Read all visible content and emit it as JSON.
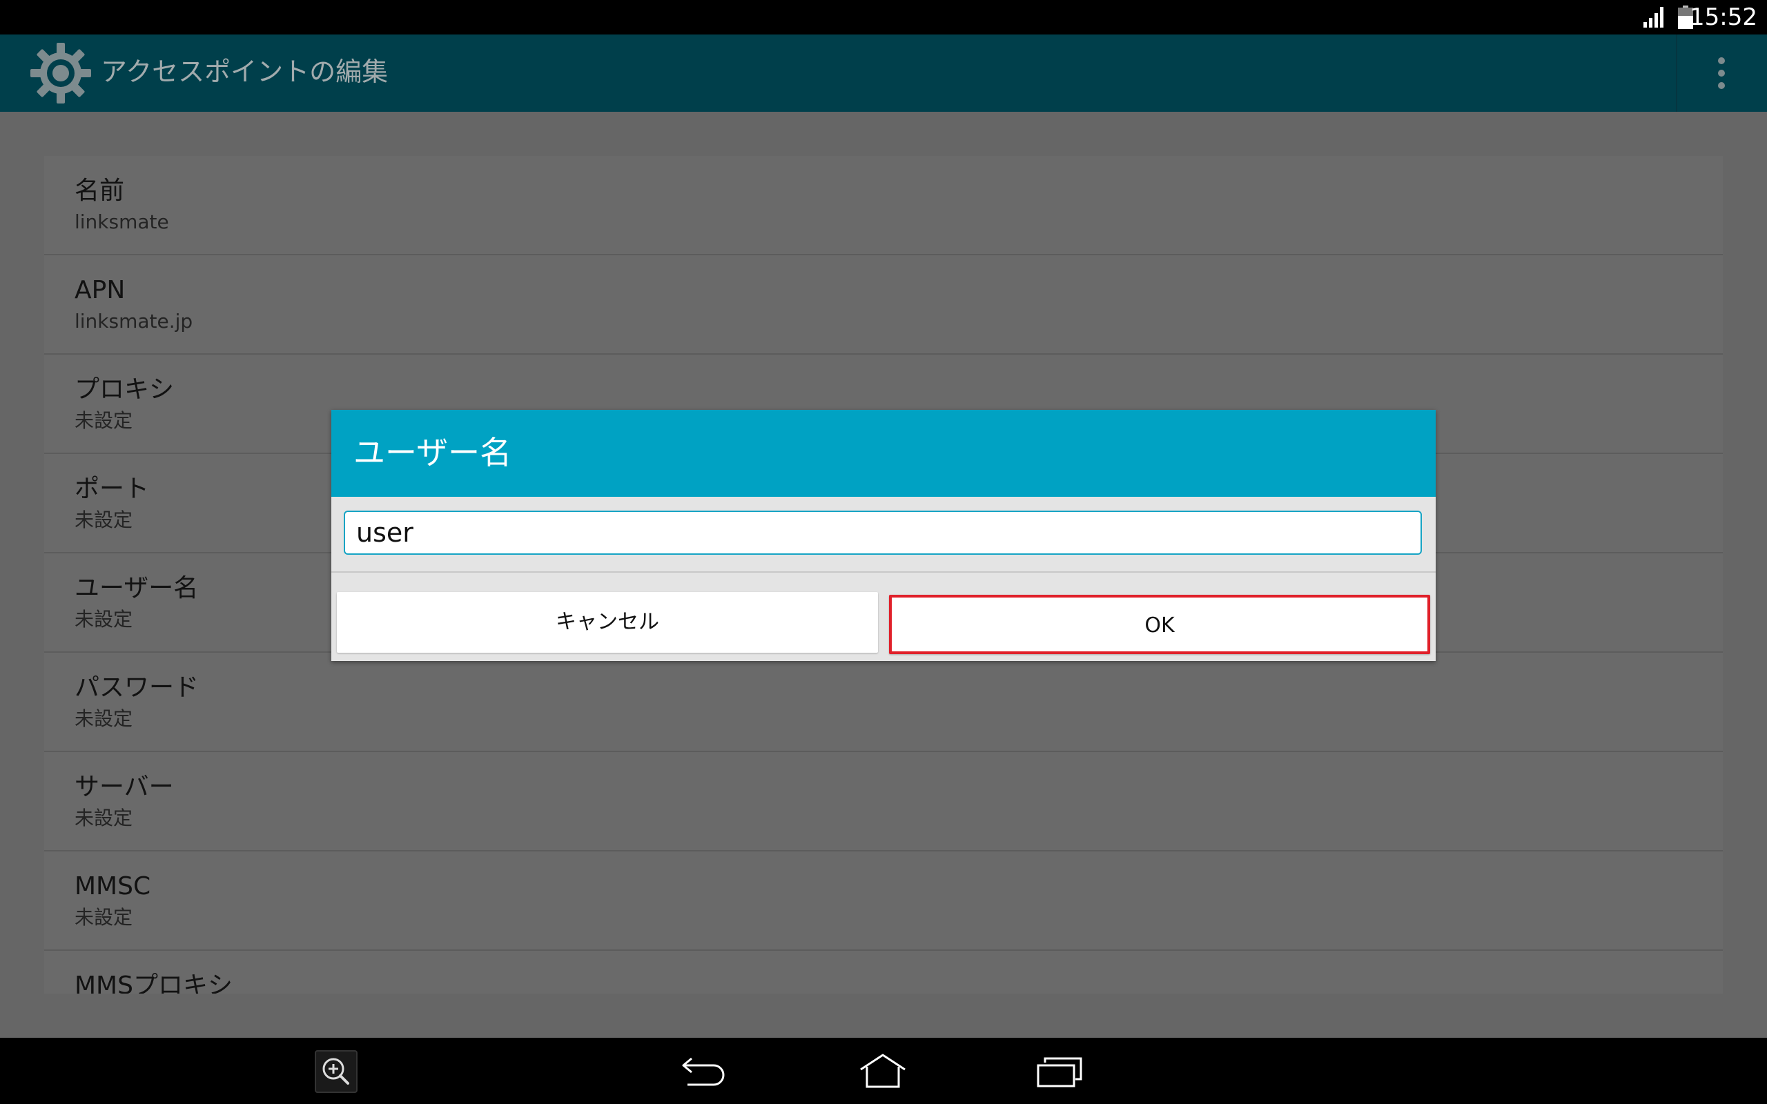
{
  "status_bar": {
    "time": "15:52"
  },
  "action_bar": {
    "title": "アクセスポイントの編集",
    "icons": {
      "app": "gear-icon",
      "menu": "overflow-menu-icon"
    }
  },
  "settings": {
    "items": [
      {
        "title": "名前",
        "summary": "linksmate"
      },
      {
        "title": "APN",
        "summary": "linksmate.jp"
      },
      {
        "title": "プロキシ",
        "summary": "未設定"
      },
      {
        "title": "ポート",
        "summary": "未設定"
      },
      {
        "title": "ユーザー名",
        "summary": "未設定"
      },
      {
        "title": "パスワード",
        "summary": "未設定"
      },
      {
        "title": "サーバー",
        "summary": "未設定"
      },
      {
        "title": "MMSC",
        "summary": "未設定"
      },
      {
        "title": "MMSプロキシ",
        "summary": ""
      }
    ]
  },
  "dialog": {
    "title": "ユーザー名",
    "input_value": "user",
    "cancel_label": "キャンセル",
    "ok_label": "OK"
  },
  "colors": {
    "action_bar": "#003f4b",
    "dialog_header": "#00a2c3",
    "highlight": "#e0202a"
  }
}
